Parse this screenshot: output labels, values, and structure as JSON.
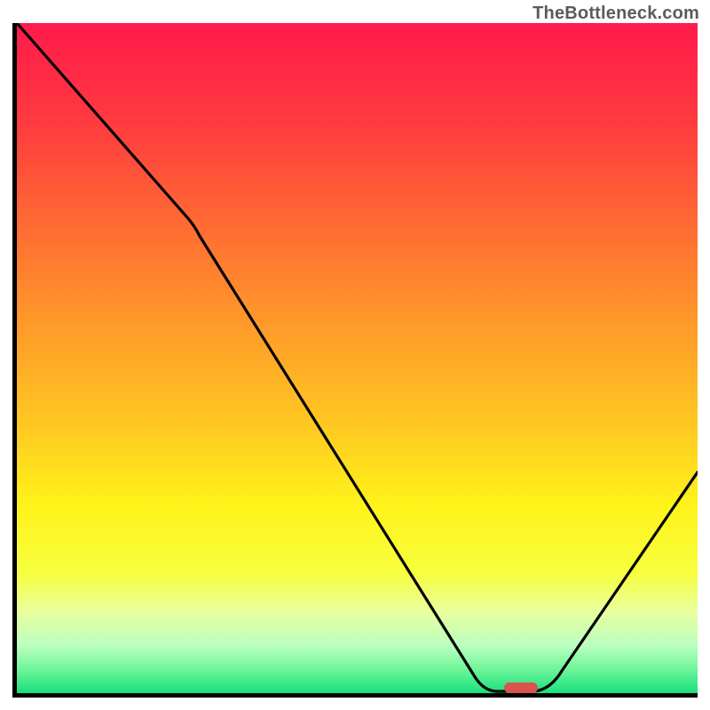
{
  "watermark": "TheBottleneck.com",
  "chart_data": {
    "type": "line",
    "title": "",
    "xlabel": "",
    "ylabel": "",
    "xlim": [
      0,
      100
    ],
    "ylim": [
      0,
      100
    ],
    "series": [
      {
        "name": "curve",
        "x": [
          0,
          25,
          70,
          78,
          100
        ],
        "y": [
          100,
          71,
          0,
          0,
          33
        ]
      }
    ],
    "annotations": [
      {
        "name": "optimum-marker",
        "x": 74,
        "y": 0,
        "color": "#d9534f"
      }
    ],
    "background": {
      "type": "vertical-gradient",
      "stops": [
        {
          "offset": 0.0,
          "color": "#ff1a4b"
        },
        {
          "offset": 0.15,
          "color": "#ff3b3f"
        },
        {
          "offset": 0.3,
          "color": "#ff6a33"
        },
        {
          "offset": 0.45,
          "color": "#ff9a2a"
        },
        {
          "offset": 0.6,
          "color": "#ffc821"
        },
        {
          "offset": 0.72,
          "color": "#fff31a"
        },
        {
          "offset": 0.82,
          "color": "#f7ff3d"
        },
        {
          "offset": 0.88,
          "color": "#e8ffa0"
        },
        {
          "offset": 0.93,
          "color": "#b9ffc0"
        },
        {
          "offset": 0.965,
          "color": "#6df598"
        },
        {
          "offset": 1.0,
          "color": "#18e07e"
        }
      ]
    }
  },
  "marker_color": "#d9534f",
  "curve_stroke": "#000000"
}
